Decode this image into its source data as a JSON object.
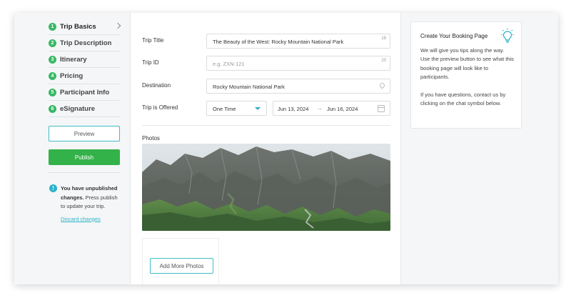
{
  "sidebar": {
    "steps": [
      {
        "num": "1",
        "label": "Trip Basics"
      },
      {
        "num": "2",
        "label": "Trip Description"
      },
      {
        "num": "3",
        "label": "Itinerary"
      },
      {
        "num": "4",
        "label": "Pricing"
      },
      {
        "num": "5",
        "label": "Participant Info"
      },
      {
        "num": "6",
        "label": "eSignature"
      }
    ],
    "preview_label": "Preview",
    "publish_label": "Publish",
    "notice": {
      "icon_text": "!",
      "bold": "You have unpublished changes.",
      "text": " Press publish to update your trip.",
      "link": "Discard changes"
    }
  },
  "form": {
    "trip_title": {
      "label": "Trip Title",
      "value": "The Beauty of the West: Rocky Mountain National Park",
      "counter": "18"
    },
    "trip_id": {
      "label": "Trip ID",
      "placeholder": "e.g. ZXN-121",
      "counter": "20"
    },
    "destination": {
      "label": "Destination",
      "value": "Rocky Mountain National Park"
    },
    "offered": {
      "label": "Trip is Offered",
      "value": "One Time",
      "date_from": "Jun 13, 2024",
      "arrow": "→",
      "date_to": "Jun 16, 2024"
    },
    "photos_label": "Photos",
    "add_photos_label": "Add More Photos"
  },
  "tips": {
    "title": "Create Your Booking Page",
    "paragraph1": "We will give you tips along the way. Use the preview button to see what this booking page will look like to participants.",
    "paragraph2": "If you have questions, contact us by clicking on the chat symbol below."
  },
  "colors": {
    "accent": "#2bb3c9",
    "publish": "#34b24a",
    "step": "#38b866"
  },
  "icons": {
    "chevron": "chevron-right-icon",
    "pin": "location-pin-icon",
    "calendar": "calendar-icon",
    "bulb": "lightbulb-icon",
    "info": "info-icon"
  }
}
